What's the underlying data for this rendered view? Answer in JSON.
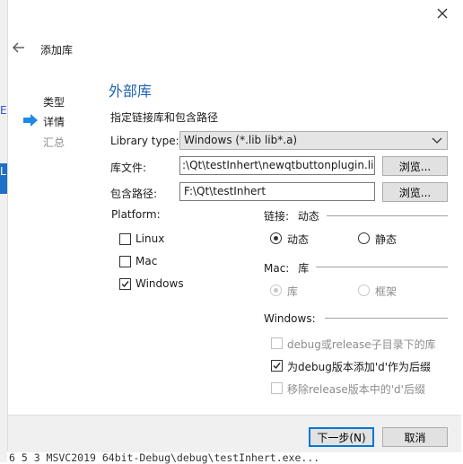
{
  "dialog": {
    "title": "添加库",
    "cancel_label": "取消",
    "next_label": "下一步(N)"
  },
  "sidebar": {
    "items": [
      {
        "label": "类型"
      },
      {
        "label": "详情"
      },
      {
        "label": "汇总"
      }
    ]
  },
  "page": {
    "heading": "外部库",
    "subheading": "指定链接库和包含路径"
  },
  "form": {
    "library_type_label": "Library type:",
    "library_type_value": "Windows (*.lib lib*.a)",
    "library_file_label": "库文件:",
    "library_file_value": ":\\Qt\\testInhert\\newqtbuttonplugin.lib",
    "include_path_label": "包含路径:",
    "include_path_value": "F:\\Qt\\testInhert",
    "browse_label": "浏览..."
  },
  "platform": {
    "title": "Platform:",
    "options": [
      {
        "label": "Linux",
        "checked": false
      },
      {
        "label": "Mac",
        "checked": false
      },
      {
        "label": "Windows",
        "checked": true
      }
    ]
  },
  "linkage": {
    "title": "链接:",
    "title_value": "动态",
    "dynamic_label": "动态",
    "static_label": "静态"
  },
  "mac": {
    "title": "Mac:",
    "title_value": "库",
    "library_label": "库",
    "framework_label": "框架"
  },
  "windows": {
    "title": "Windows:",
    "options": [
      {
        "label": "debug或release子目录下的库",
        "checked": false,
        "enabled": false
      },
      {
        "label": "为debug版本添加'd'作为后缀",
        "checked": true,
        "enabled": true
      },
      {
        "label": "移除release版本中的'd'后缀",
        "checked": false,
        "enabled": false
      }
    ]
  },
  "background": {
    "left_letter_e": "E",
    "left_letter_l": "L",
    "terminal_text": "6 5 3 MSVC2019 64bit-Debug\\debug\\testInhert.exe..."
  },
  "colors": {
    "accent": "#0078d7",
    "heading": "#1e63b0",
    "arrow": "#1e88e5"
  }
}
